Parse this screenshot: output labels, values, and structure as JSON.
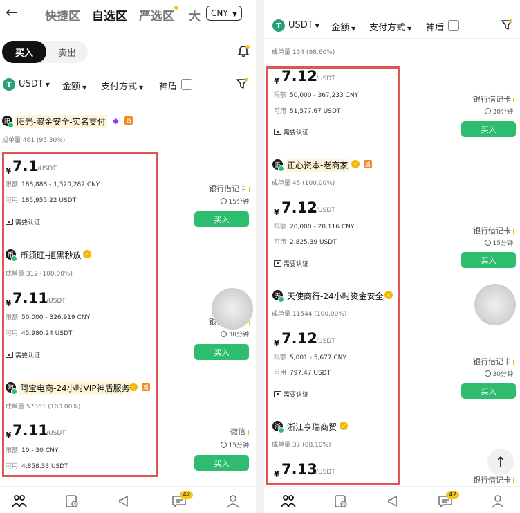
{
  "left": {
    "header": {
      "tabs": [
        "快捷区",
        "自选区",
        "严选区",
        "大"
      ],
      "active_tab": "自选区",
      "currency": "CNY"
    },
    "trade_toggle": {
      "buy": "买入",
      "sell": "卖出"
    },
    "filters": {
      "coin": "USDT",
      "amount": "金额",
      "payment": "支付方式",
      "shield": "神盾"
    },
    "listings": [
      {
        "avatar": "阳",
        "name": "阳光-资金安全-实名支付",
        "orders_label": "成单量",
        "orders": "461 (95.30%)",
        "currency_symbol": "¥",
        "price": "7.1",
        "unit": "/USDT",
        "limit_label": "限额",
        "limit": "188,888 - 1,320,282 CNY",
        "available_label": "可用",
        "available": "185,955.22 USDT",
        "verify": "需要认证",
        "payment": "银行借记卡",
        "time": "15分钟",
        "buy": "买入"
      },
      {
        "avatar": "币",
        "name": "币须旺-拒黑秒放",
        "orders_label": "成单量",
        "orders": "312 (100.00%)",
        "currency_symbol": "¥",
        "price": "7.11",
        "unit": "/USDT",
        "limit_label": "限额",
        "limit": "50,000 - 326,919 CNY",
        "available_label": "可用",
        "available": "45,980.24 USDT",
        "verify": "需要认证",
        "payment": "银行借记卡",
        "time": "30分钟",
        "buy": "买入"
      },
      {
        "avatar": "阿",
        "name": "阿宝电商-24小时VIP神盾服务",
        "orders_label": "成单量",
        "orders": "57061 (100.00%)",
        "currency_symbol": "¥",
        "price": "7.11",
        "unit": "/USDT",
        "limit_label": "限额",
        "limit": "10 - 30 CNY",
        "available_label": "可用",
        "available": "4,858.33 USDT",
        "payment": "微信",
        "time": "15分钟",
        "buy": "买入"
      }
    ],
    "nav_badge": "42"
  },
  "right": {
    "filters": {
      "coin": "USDT",
      "amount": "金额",
      "payment": "支付方式",
      "shield": "神盾"
    },
    "top_orders": {
      "label": "成单量",
      "value": "134 (98.60%)"
    },
    "listings": [
      {
        "currency_symbol": "¥",
        "price": "7.12",
        "unit": "/USDT",
        "limit_label": "限额",
        "limit": "50,000 - 367,233 CNY",
        "available_label": "可用",
        "available": "51,577.67 USDT",
        "verify": "需要认证",
        "payment": "银行借记卡",
        "time": "30分钟",
        "buy": "买入"
      },
      {
        "avatar": "正",
        "name": "正心资本-老商家",
        "orders_label": "成单量",
        "orders": "45 (100.00%)",
        "currency_symbol": "¥",
        "price": "7.12",
        "unit": "/USDT",
        "limit_label": "限额",
        "limit": "20,000 - 20,116 CNY",
        "available_label": "可用",
        "available": "2,825.39 USDT",
        "verify": "需要认证",
        "payment": "银行借记卡",
        "time": "15分钟",
        "buy": "买入"
      },
      {
        "avatar": "天",
        "name": "天使商行-24小时资金安全",
        "orders_label": "成单量",
        "orders": "11544 (100.00%)",
        "currency_symbol": "¥",
        "price": "7.12",
        "unit": "/USDT",
        "limit_label": "限额",
        "limit": "5,001 - 5,677 CNY",
        "available_label": "可用",
        "available": "797.47 USDT",
        "verify": "需要认证",
        "payment": "银行借记卡",
        "time": "30分钟",
        "buy": "买入"
      },
      {
        "avatar": "浙",
        "name": "浙江亨瑞商贸",
        "orders_label": "成单量",
        "orders": "37 (88.10%)",
        "currency_symbol": "¥",
        "price": "7.13",
        "unit": "/USDT",
        "payment": "银行借记卡"
      }
    ],
    "nav_badge": "42"
  },
  "colors": {
    "buy_green": "#2ebd6e",
    "highlight_red": "#e05452",
    "badge_yellow": "#f5c518"
  }
}
